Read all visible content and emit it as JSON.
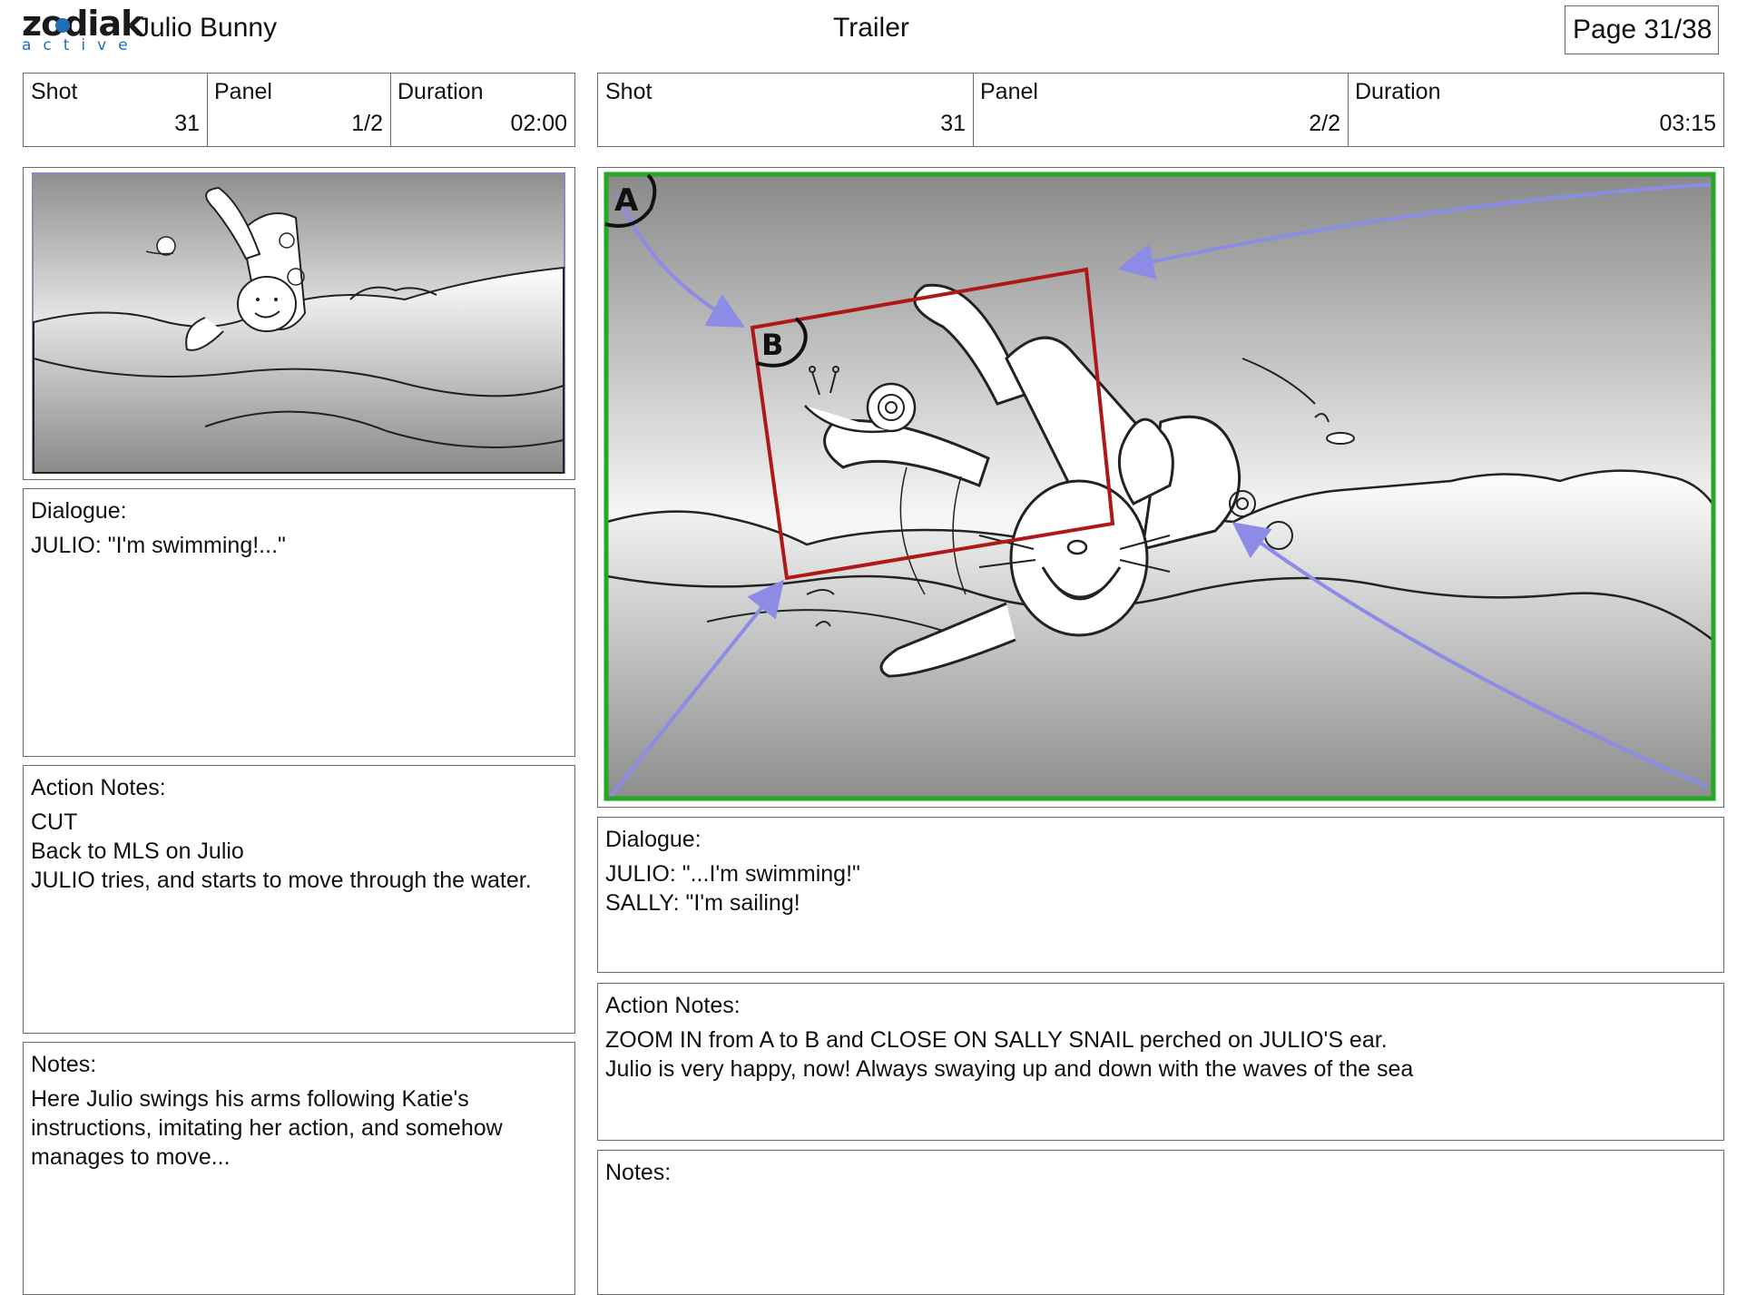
{
  "header": {
    "logo_word": "zodiak",
    "logo_sub": "active",
    "series_title": "Julio Bunny",
    "episode_title": "Trailer",
    "page_label": "Page 31/38"
  },
  "left_panel": {
    "shot_label": "Shot",
    "shot_value": "31",
    "panel_label": "Panel",
    "panel_value": "1/2",
    "duration_label": "Duration",
    "duration_value": "02:00",
    "dialogue_label": "Dialogue:",
    "dialogue_lines": [
      "JULIO: \"I'm swimming!...\""
    ],
    "action_label": "Action Notes:",
    "action_lines": [
      "CUT",
      "Back to MLS on Julio",
      "JULIO tries, and starts to move through the water."
    ],
    "notes_label": "Notes:",
    "notes_lines": [
      "Here Julio swings his arms following Katie's",
      "instructions, imitating her action, and somehow",
      "manages to move..."
    ]
  },
  "right_panel": {
    "shot_label": "Shot",
    "shot_value": "31",
    "panel_label": "Panel",
    "panel_value": "2/2",
    "duration_label": "Duration",
    "duration_value": "03:15",
    "frame_markers": [
      "A",
      "B"
    ],
    "dialogue_label": "Dialogue:",
    "dialogue_lines": [
      "JULIO: \"...I'm swimming!\"",
      "SALLY: \"I'm sailing!"
    ],
    "action_label": "Action Notes:",
    "action_lines": [
      "ZOOM IN from A to B and CLOSE ON SALLY SNAIL perched on JULIO'S ear.",
      "Julio is very happy, now! Always swaying up and down with the waves of the sea"
    ],
    "notes_label": "Notes:",
    "notes_lines": []
  },
  "colors": {
    "frame_green": "#22aa22",
    "zoom_box_red": "#b01818",
    "arrow_blue": "#8c8ce6",
    "logo_blue": "#1f6fb8",
    "sky_gray": "#8a8a8a"
  }
}
